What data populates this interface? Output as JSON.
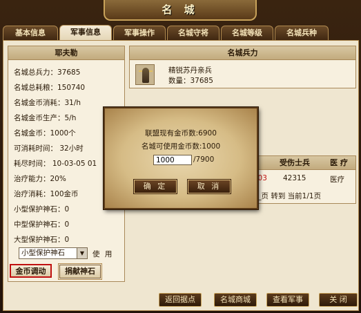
{
  "window": {
    "title": "名 城"
  },
  "tabs": [
    {
      "label": "基本信息"
    },
    {
      "label": "军事信息"
    },
    {
      "label": "军事操作"
    },
    {
      "label": "名城守将"
    },
    {
      "label": "名城等级"
    },
    {
      "label": "名城兵种"
    }
  ],
  "active_tab": "军事信息",
  "left_panel": {
    "title": "耶夫勒",
    "lines": [
      "名城总兵力：37685",
      "名城总耗粮：150740",
      "名城金币消耗：31/h",
      "名城金币生产：5/h",
      "名城金币：1000个",
      "可消耗时间： 32小时",
      "耗尽时间： 10-03-05 01",
      "治疗能力：20%",
      "治疗消耗：100金币",
      "小型保护神石：0",
      "中型保护神石：0",
      "大型保护神石：0"
    ],
    "select_value": "小型保护神石",
    "use_label": "使 用",
    "gold_transfer_button": "金币调动",
    "donate_stone_button": "捐献神石"
  },
  "troops_panel": {
    "title": "名城兵力",
    "troop_name": "精锐苏丹亲兵",
    "troop_count": "数量：37685"
  },
  "wounded_table": {
    "headers": [
      "时间",
      "受伤士兵",
      "医 疗"
    ],
    "row": {
      "time": ":03",
      "wounded": "42315",
      "action": "医疗"
    },
    "pager": "__页 转到 当前1/1页"
  },
  "dialog": {
    "alliance_gold": "联盟现有金币数:6900",
    "city_gold": "名城可使用金币数:1000",
    "input_value": "1000",
    "max_text": "/7900",
    "confirm": "确 定",
    "cancel": "取 消"
  },
  "bottom_buttons": {
    "return": "返回据点",
    "shop": "名城商城",
    "military": "查看军事",
    "close": "关 闭"
  },
  "colors": {
    "frame": "#2b1a0c",
    "parchment": "#efe6d0",
    "accent_gold": "#c9a35a",
    "highlight_red": "#c01010"
  }
}
